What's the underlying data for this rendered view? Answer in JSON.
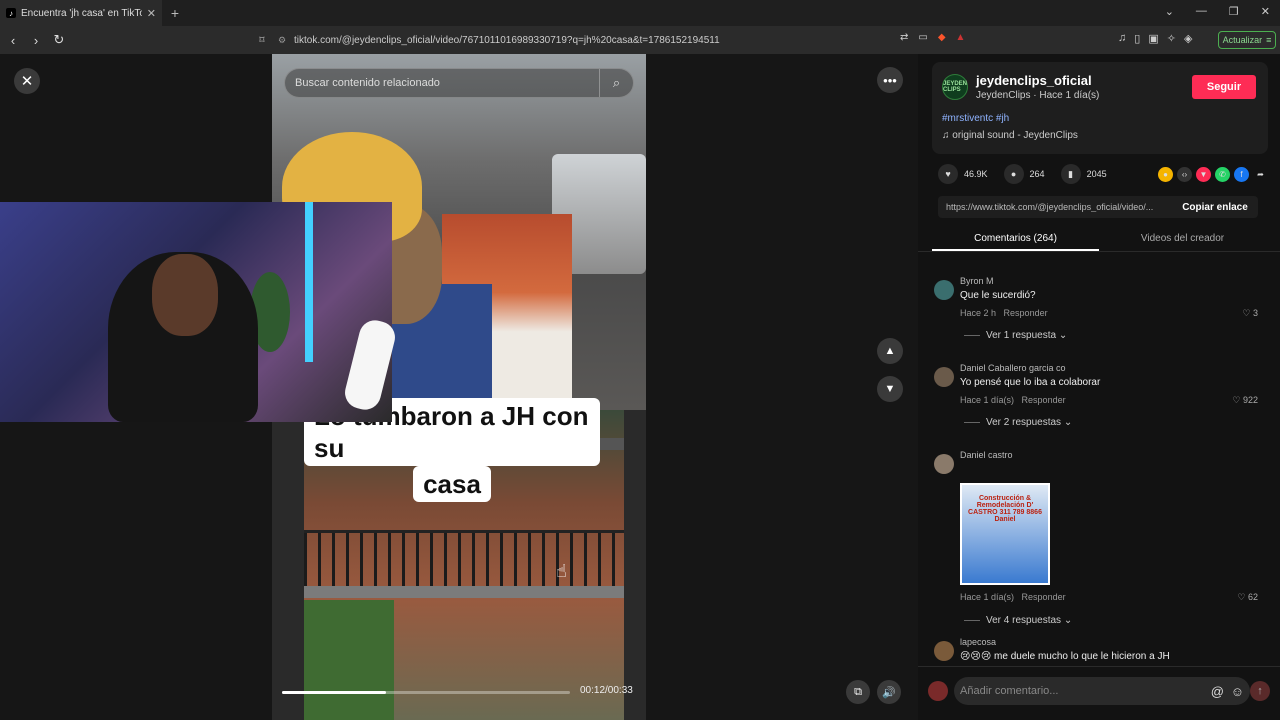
{
  "browser": {
    "tab_title": "Encuentra 'jh casa' en TikTok",
    "url": "tiktok.com/@jeydenclips_oficial/video/7671011016989330719?q=jh%20casa&t=1786152194511",
    "update_label": "Actualizar"
  },
  "viewer": {
    "search_placeholder": "Buscar contenido relacionado",
    "caption_line1": "Lo tumbaron a JH con su",
    "caption_line2": "casa",
    "time": "00:12/00:33",
    "progress": 0.36
  },
  "creator": {
    "username": "jeydenclips_oficial",
    "meta": "JeydenClips · Hace 1 día(s)",
    "avatar_text": "JEYDEN CLIPS",
    "follow_label": "Seguir",
    "hashtags": "#mrstiventc #jh",
    "sound": "original sound - JeydenClips"
  },
  "stats": {
    "likes": "46.9K",
    "comments": "264",
    "saves": "2045"
  },
  "link": {
    "url": "https://www.tiktok.com/@jeydenclips_oficial/video/...",
    "copy_label": "Copiar enlace"
  },
  "tabs": {
    "comments": "Comentarios (264)",
    "creator_videos": "Videos del creador"
  },
  "comments": [
    {
      "name": "Byron M",
      "text": "Que le sucerdió?",
      "time": "Hace 2 h",
      "reply": "Responder",
      "likes": "3",
      "replies": "Ver 1 respuesta"
    },
    {
      "name": "Daniel Caballero garcia co",
      "text": "Yo pensé que lo iba a colaborar",
      "time": "Hace 1 día(s)",
      "reply": "Responder",
      "likes": "922",
      "replies": "Ver 2 respuestas"
    },
    {
      "name": "Daniel castro",
      "text": "Construcción & Remodelación D' CASTRO 311 789 8866 Daniel",
      "time": "Hace 1 día(s)",
      "reply": "Responder",
      "likes": "62",
      "replies": "Ver 4 respuestas"
    },
    {
      "name": "lapecosa",
      "text": "😢😢😢 me duele mucho lo que le hicieron a JH",
      "time": "",
      "reply": "",
      "likes": "",
      "replies": ""
    }
  ],
  "input": {
    "placeholder": "Añadir comentario..."
  }
}
